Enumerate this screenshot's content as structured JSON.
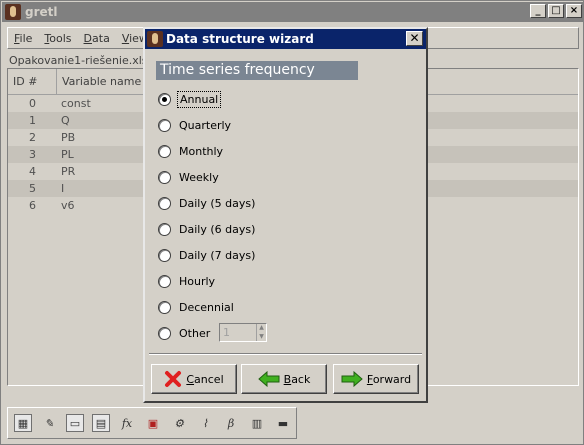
{
  "main_window": {
    "title": "gretl",
    "controls": {
      "minimize": "_",
      "maximize": "□",
      "close": "×"
    },
    "menu": [
      {
        "key": "F",
        "rest": "ile"
      },
      {
        "key": "T",
        "rest": "ools"
      },
      {
        "key": "D",
        "rest": "ata"
      },
      {
        "key": "V",
        "rest": "iew"
      }
    ],
    "filename": "Opakovanie1-riešenie.xls",
    "table": {
      "headers": {
        "id": "ID #",
        "name": "Variable name"
      },
      "rows": [
        {
          "id": "0",
          "name": "const"
        },
        {
          "id": "1",
          "name": "Q"
        },
        {
          "id": "2",
          "name": "PB"
        },
        {
          "id": "3",
          "name": "PL"
        },
        {
          "id": "4",
          "name": "PR"
        },
        {
          "id": "5",
          "name": "I"
        },
        {
          "id": "6",
          "name": "v6"
        }
      ]
    },
    "toolbar_icons": [
      "calculator-icon",
      "edit-icon",
      "window-icon",
      "table-icon",
      "function-icon",
      "pdf-icon",
      "settings-icon",
      "chart-icon",
      "beta-icon",
      "notes-icon",
      "folder-icon"
    ],
    "fx_label": "fx"
  },
  "dialog": {
    "title": "Data structure wizard",
    "close_glyph": "✕",
    "heading": "Time series frequency",
    "options": [
      {
        "label": "Annual",
        "checked": true
      },
      {
        "label": "Quarterly",
        "checked": false
      },
      {
        "label": "Monthly",
        "checked": false
      },
      {
        "label": "Weekly",
        "checked": false
      },
      {
        "label": "Daily (5 days)",
        "checked": false
      },
      {
        "label": "Daily (6 days)",
        "checked": false
      },
      {
        "label": "Daily (7 days)",
        "checked": false
      },
      {
        "label": "Hourly",
        "checked": false
      },
      {
        "label": "Decennial",
        "checked": false
      },
      {
        "label": "Other",
        "checked": false
      }
    ],
    "other_value": "1",
    "buttons": {
      "cancel": {
        "key": "C",
        "rest": "ancel"
      },
      "back": {
        "key": "B",
        "rest": "ack"
      },
      "forward": {
        "key": "F",
        "rest": "orward"
      }
    }
  },
  "colors": {
    "dialog_titlebar": "#0a246a",
    "heading_bg": "#7b8693",
    "cancel_icon": "#e02020",
    "arrow_icon": "#40b020"
  }
}
